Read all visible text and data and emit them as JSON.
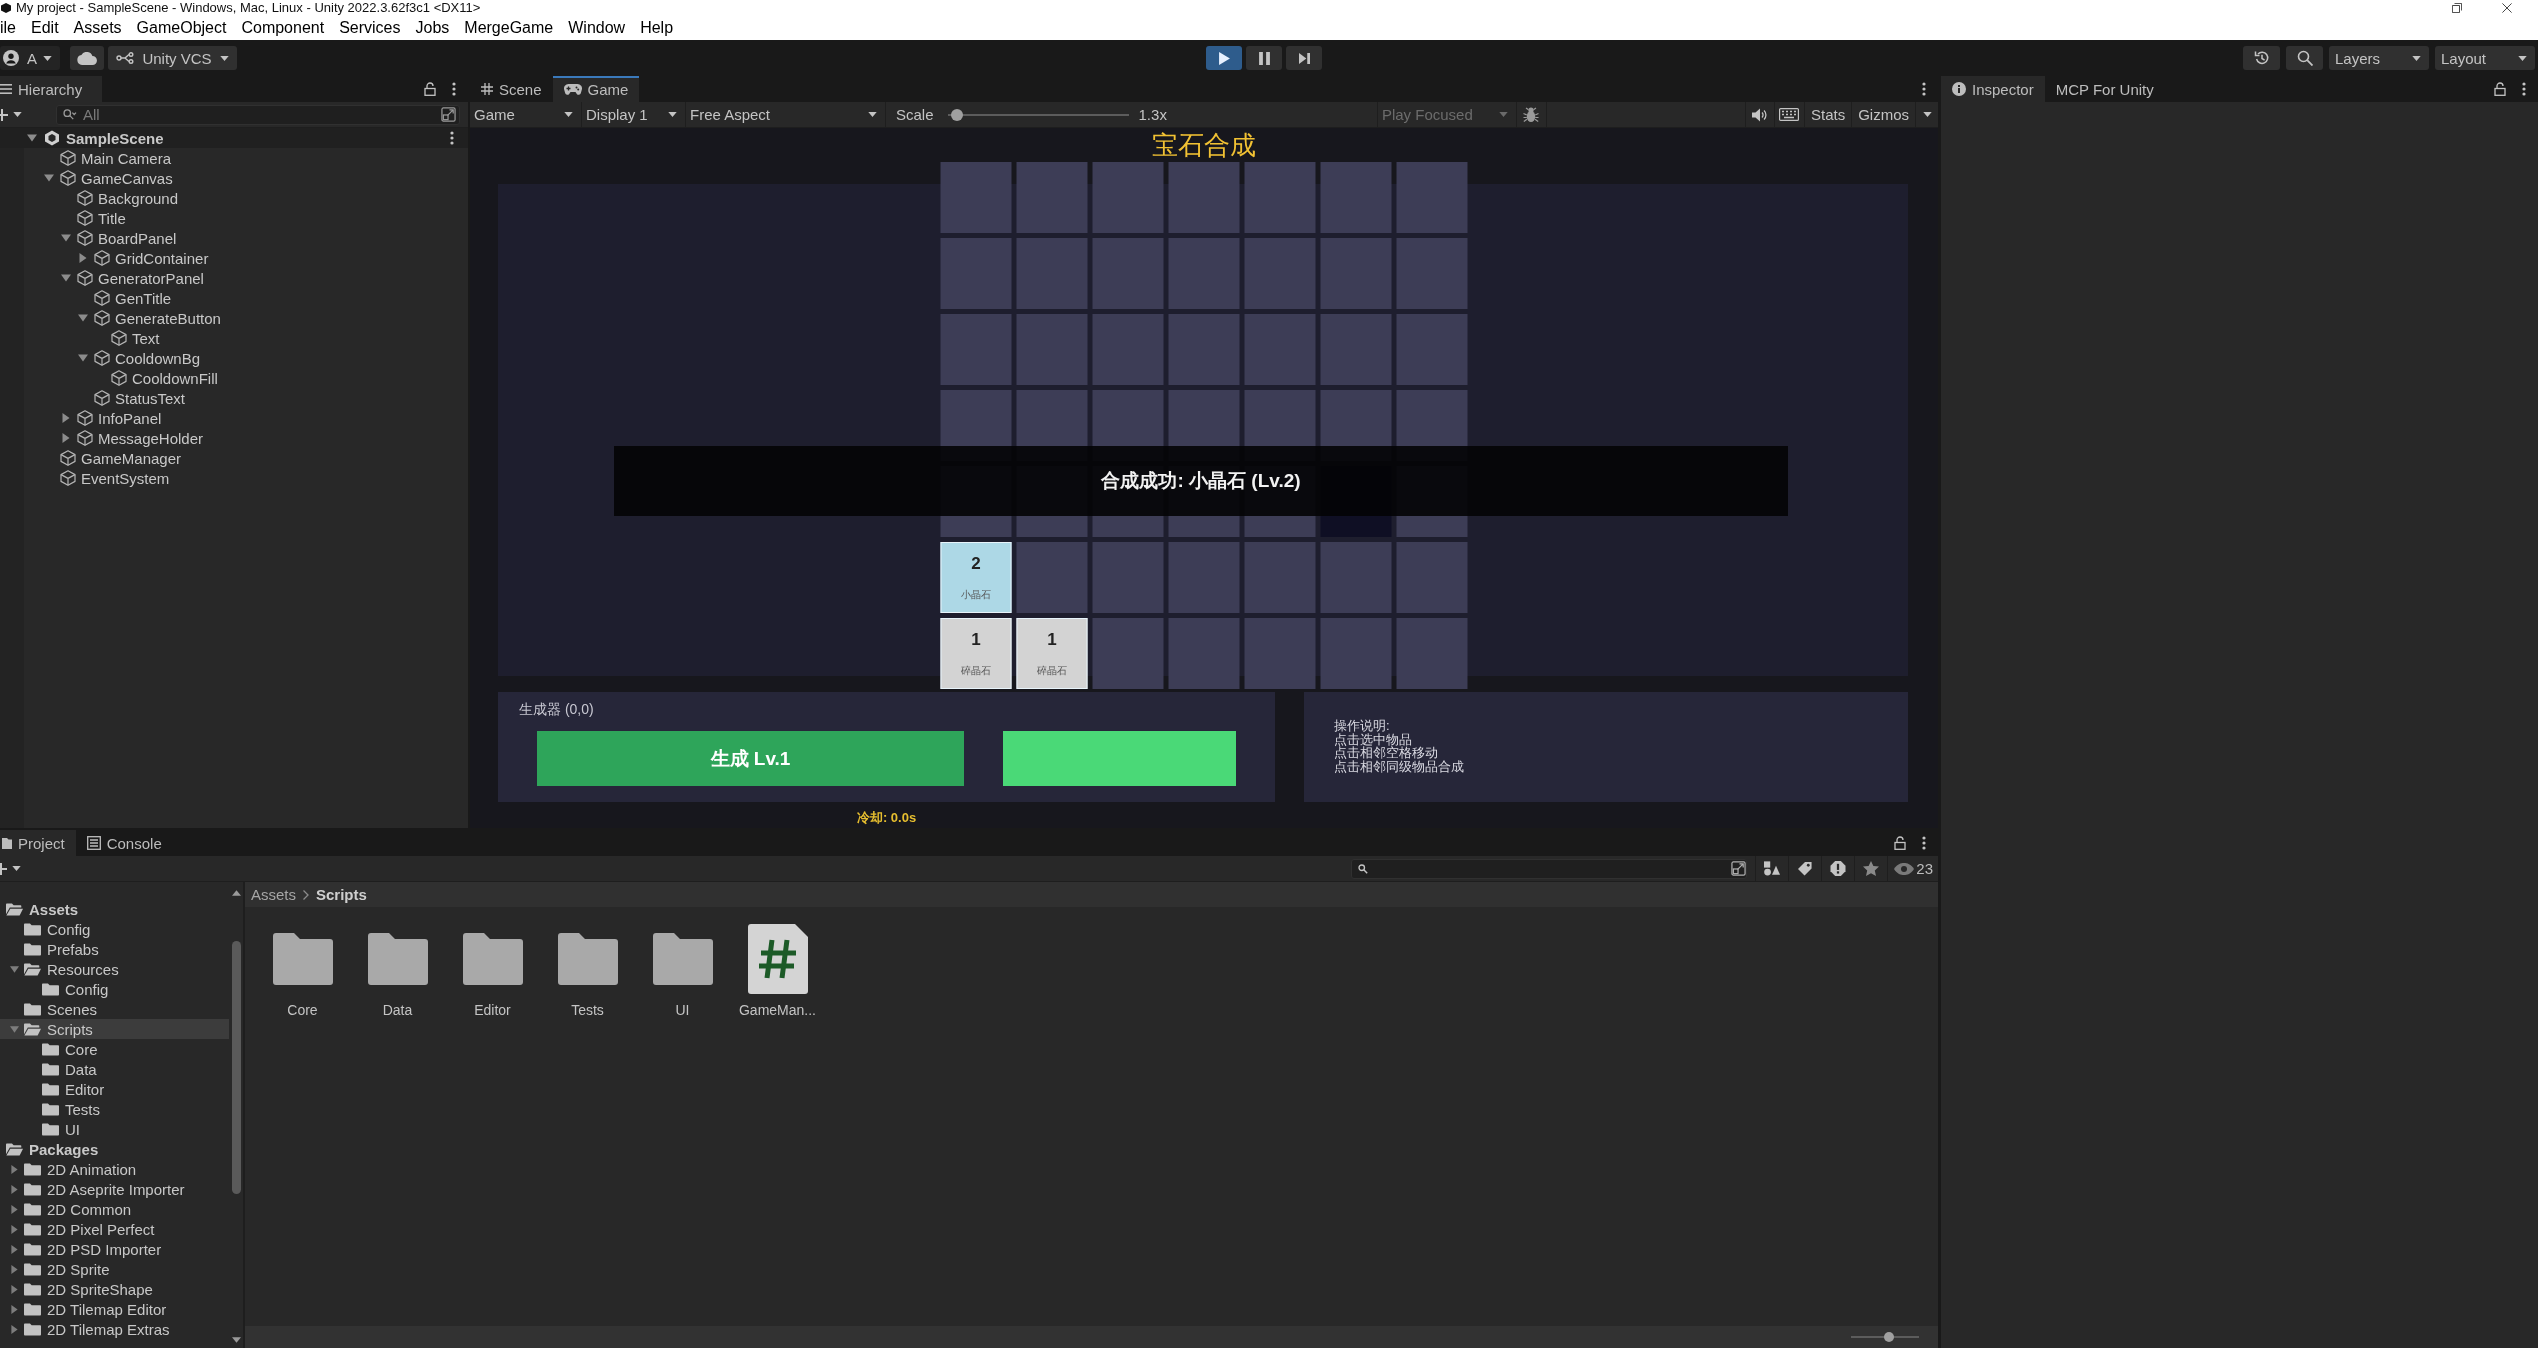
{
  "window": {
    "title": "My project - SampleScene - Windows, Mac, Linux - Unity 2022.3.62f3c1 <DX11>"
  },
  "menu": [
    "ile",
    "Edit",
    "Assets",
    "GameObject",
    "Component",
    "Services",
    "Jobs",
    "MergeGame",
    "Window",
    "Help"
  ],
  "toolbar": {
    "account": "A",
    "vcs": "Unity VCS",
    "playback": [
      {
        "kind": "play",
        "on": true
      },
      {
        "kind": "pause",
        "on": false
      },
      {
        "kind": "step",
        "on": false
      }
    ],
    "dropdowns": [
      "Layers",
      "Layout"
    ]
  },
  "hierarchy": {
    "tab": "Hierarchy",
    "search": {
      "placeholder": "All"
    },
    "items": [
      {
        "name": "SampleScene",
        "kind": "scene",
        "expanded": true,
        "children": [
          {
            "name": "Main Camera",
            "kind": "object"
          },
          {
            "name": "GameCanvas",
            "kind": "object",
            "expanded": true,
            "children": [
              {
                "name": "Background",
                "kind": "object"
              },
              {
                "name": "Title",
                "kind": "object"
              },
              {
                "name": "BoardPanel",
                "kind": "object",
                "expanded": true,
                "children": [
                  {
                    "name": "GridContainer",
                    "kind": "object",
                    "expanded": false
                  }
                ]
              },
              {
                "name": "GeneratorPanel",
                "kind": "object",
                "expanded": true,
                "children": [
                  {
                    "name": "GenTitle",
                    "kind": "object"
                  },
                  {
                    "name": "GenerateButton",
                    "kind": "object",
                    "expanded": true,
                    "children": [
                      {
                        "name": "Text",
                        "kind": "object"
                      }
                    ]
                  },
                  {
                    "name": "CooldownBg",
                    "kind": "object",
                    "expanded": true,
                    "children": [
                      {
                        "name": "CooldownFill",
                        "kind": "object"
                      }
                    ]
                  },
                  {
                    "name": "StatusText",
                    "kind": "object"
                  }
                ]
              },
              {
                "name": "InfoPanel",
                "kind": "object",
                "expanded": false
              },
              {
                "name": "MessageHolder",
                "kind": "object",
                "expanded": false
              }
            ]
          },
          {
            "name": "GameManager",
            "kind": "object"
          },
          {
            "name": "EventSystem",
            "kind": "object"
          }
        ]
      }
    ]
  },
  "scene_tabs": [
    {
      "label": "Scene",
      "kind": "scene",
      "selected": false
    },
    {
      "label": "Game",
      "kind": "game",
      "selected": true
    }
  ],
  "game_toolbar": {
    "dropdowns": [
      "Game",
      "Display 1",
      "Free Aspect"
    ],
    "scale": {
      "label": "Scale",
      "level": 0.02,
      "reading": "1.3x"
    },
    "play_focused": {
      "label": "Play Focused",
      "disabled": true
    },
    "stats": "Stats",
    "gizmos": "Gizmos"
  },
  "game": {
    "title": "宝石合成",
    "board": {
      "rows": [
        [
          {
            "kind": "empty"
          },
          {
            "kind": "empty"
          },
          {
            "kind": "empty"
          },
          {
            "kind": "empty"
          },
          {
            "kind": "empty"
          },
          {
            "kind": "empty"
          },
          {
            "kind": "empty"
          }
        ],
        [
          {
            "kind": "empty"
          },
          {
            "kind": "empty"
          },
          {
            "kind": "empty"
          },
          {
            "kind": "empty"
          },
          {
            "kind": "empty"
          },
          {
            "kind": "empty"
          },
          {
            "kind": "empty"
          }
        ],
        [
          {
            "kind": "empty"
          },
          {
            "kind": "empty"
          },
          {
            "kind": "empty"
          },
          {
            "kind": "empty"
          },
          {
            "kind": "empty"
          },
          {
            "kind": "empty"
          },
          {
            "kind": "empty"
          }
        ],
        [
          {
            "kind": "empty"
          },
          {
            "kind": "empty"
          },
          {
            "kind": "empty"
          },
          {
            "kind": "empty"
          },
          {
            "kind": "empty"
          },
          {
            "kind": "empty"
          },
          {
            "kind": "empty"
          }
        ],
        [
          {
            "kind": "empty"
          },
          {
            "kind": "empty"
          },
          {
            "kind": "empty"
          },
          {
            "kind": "empty"
          },
          {
            "kind": "empty"
          },
          {
            "kind": "dim"
          },
          {
            "kind": "empty"
          }
        ],
        [
          {
            "kind": "item",
            "value": "2",
            "name": "小晶石",
            "color": "#add8e6"
          },
          {
            "kind": "empty"
          },
          {
            "kind": "empty"
          },
          {
            "kind": "empty"
          },
          {
            "kind": "empty"
          },
          {
            "kind": "empty"
          },
          {
            "kind": "empty"
          }
        ],
        [
          {
            "kind": "item",
            "value": "1",
            "name": "碎晶石",
            "color": "#d3d3d3"
          },
          {
            "kind": "item",
            "value": "1",
            "name": "碎晶石",
            "color": "#d3d3d3"
          },
          {
            "kind": "empty"
          },
          {
            "kind": "empty"
          },
          {
            "kind": "empty"
          },
          {
            "kind": "empty"
          },
          {
            "kind": "empty"
          }
        ]
      ]
    },
    "message": "合成成功: 小晶石 (Lv.2)",
    "generator": {
      "title": "生成器 (0,0)",
      "button": "生成 Lv.1",
      "cooldown": {
        "level": 1
      }
    },
    "status": "冷却: 0.0s",
    "info": {
      "lines": [
        "操作说明:",
        "点击选中物品",
        "点击相邻空格移动",
        "点击相邻同级物品合成"
      ]
    }
  },
  "inspector_tabs": [
    {
      "label": "Inspector",
      "kind": "inspector",
      "selected": true
    },
    {
      "label": "MCP For Unity",
      "kind": "plain",
      "selected": false
    }
  ],
  "project": {
    "tabs": [
      {
        "label": "Project",
        "kind": "project",
        "selected": true
      },
      {
        "label": "Console",
        "kind": "console",
        "selected": false
      }
    ],
    "tree": [
      {
        "name": "Assets",
        "kind": "root",
        "expanded": true,
        "selected": false,
        "children": [
          {
            "name": "Config",
            "kind": "folder",
            "selected": false
          },
          {
            "name": "Prefabs",
            "kind": "folder",
            "selected": false
          },
          {
            "name": "Resources",
            "kind": "folder",
            "expanded": true,
            "selected": false,
            "children": [
              {
                "name": "Config",
                "kind": "folder",
                "selected": false
              }
            ]
          },
          {
            "name": "Scenes",
            "kind": "folder",
            "selected": false
          },
          {
            "name": "Scripts",
            "kind": "folder",
            "expanded": true,
            "selected": true,
            "children": [
              {
                "name": "Core",
                "kind": "folder",
                "selected": false
              },
              {
                "name": "Data",
                "kind": "folder",
                "selected": false
              },
              {
                "name": "Editor",
                "kind": "folder",
                "selected": false
              },
              {
                "name": "Tests",
                "kind": "folder",
                "selected": false
              },
              {
                "name": "UI",
                "kind": "folder",
                "selected": false
              }
            ]
          }
        ]
      },
      {
        "name": "Packages",
        "kind": "root",
        "expanded": true,
        "selected": false,
        "children": [
          {
            "name": "2D Animation",
            "kind": "folder",
            "expanded": false,
            "selected": false
          },
          {
            "name": "2D Aseprite Importer",
            "kind": "folder",
            "expanded": false,
            "selected": false
          },
          {
            "name": "2D Common",
            "kind": "folder",
            "expanded": false,
            "selected": false
          },
          {
            "name": "2D Pixel Perfect",
            "kind": "folder",
            "expanded": false,
            "selected": false
          },
          {
            "name": "2D PSD Importer",
            "kind": "folder",
            "expanded": false,
            "selected": false
          },
          {
            "name": "2D Sprite",
            "kind": "folder",
            "expanded": false,
            "selected": false
          },
          {
            "name": "2D SpriteShape",
            "kind": "folder",
            "expanded": false,
            "selected": false
          },
          {
            "name": "2D Tilemap Editor",
            "kind": "folder",
            "expanded": false,
            "selected": false
          },
          {
            "name": "2D Tilemap Extras",
            "kind": "folder",
            "expanded": false,
            "selected": false
          }
        ]
      }
    ],
    "breadcrumb": [
      "Assets",
      "Scripts"
    ],
    "items": [
      {
        "name": "Core",
        "kind": "folder"
      },
      {
        "name": "Data",
        "kind": "folder"
      },
      {
        "name": "Editor",
        "kind": "folder"
      },
      {
        "name": "Tests",
        "kind": "folder"
      },
      {
        "name": "UI",
        "kind": "folder"
      },
      {
        "name": "GameMan...",
        "kind": "script"
      }
    ],
    "hidden_count": "23",
    "icon_size": {
      "level": 0.57
    }
  }
}
